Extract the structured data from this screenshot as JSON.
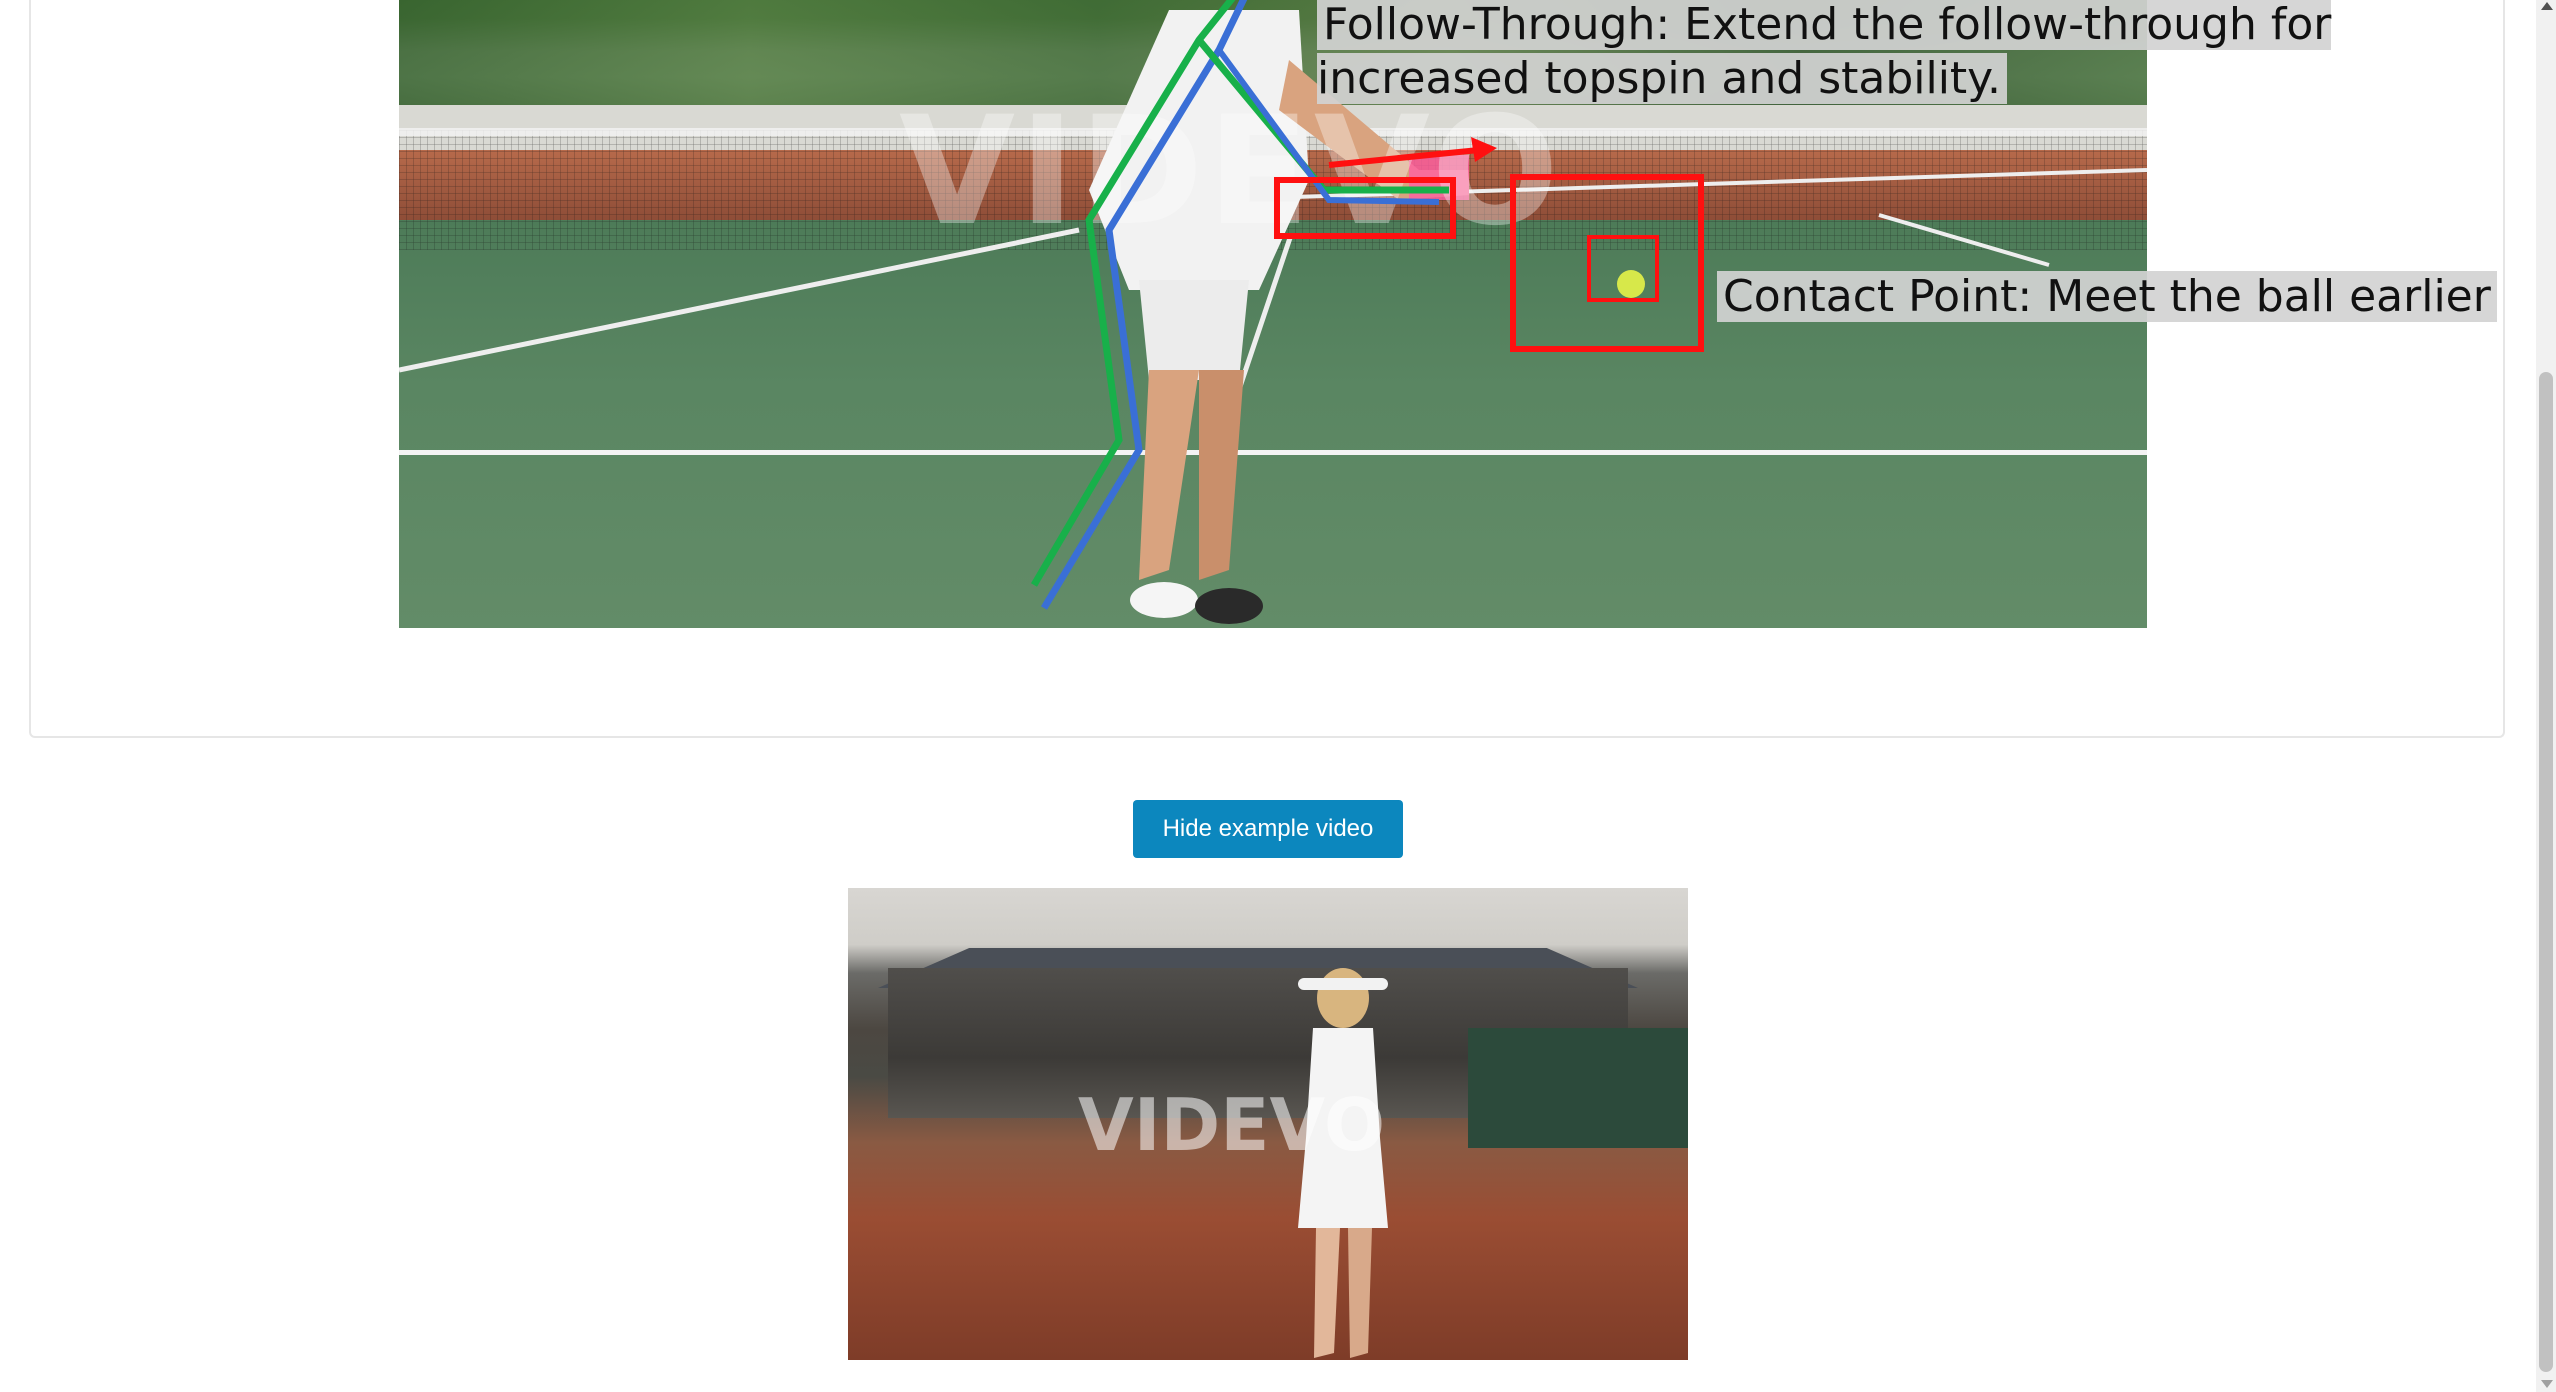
{
  "analysis": {
    "annotations": {
      "follow_through": "Follow-Through: Extend the follow-through for increased topspin and stability.",
      "contact_point": "Contact Point: Meet the ball earlier"
    },
    "watermark": "VIDEVO",
    "colors": {
      "box": "#ff1010",
      "arrow": "#ff1010",
      "skeleton_green": "#18b04a",
      "skeleton_blue": "#3a6fd6"
    }
  },
  "controls": {
    "toggle_video_label": "Hide example video",
    "button_color": "#0c87be"
  },
  "example_video": {
    "watermark": "VIDEVO"
  },
  "scrollbar": {
    "up_icon": "triangle-up",
    "down_icon": "triangle-down"
  }
}
